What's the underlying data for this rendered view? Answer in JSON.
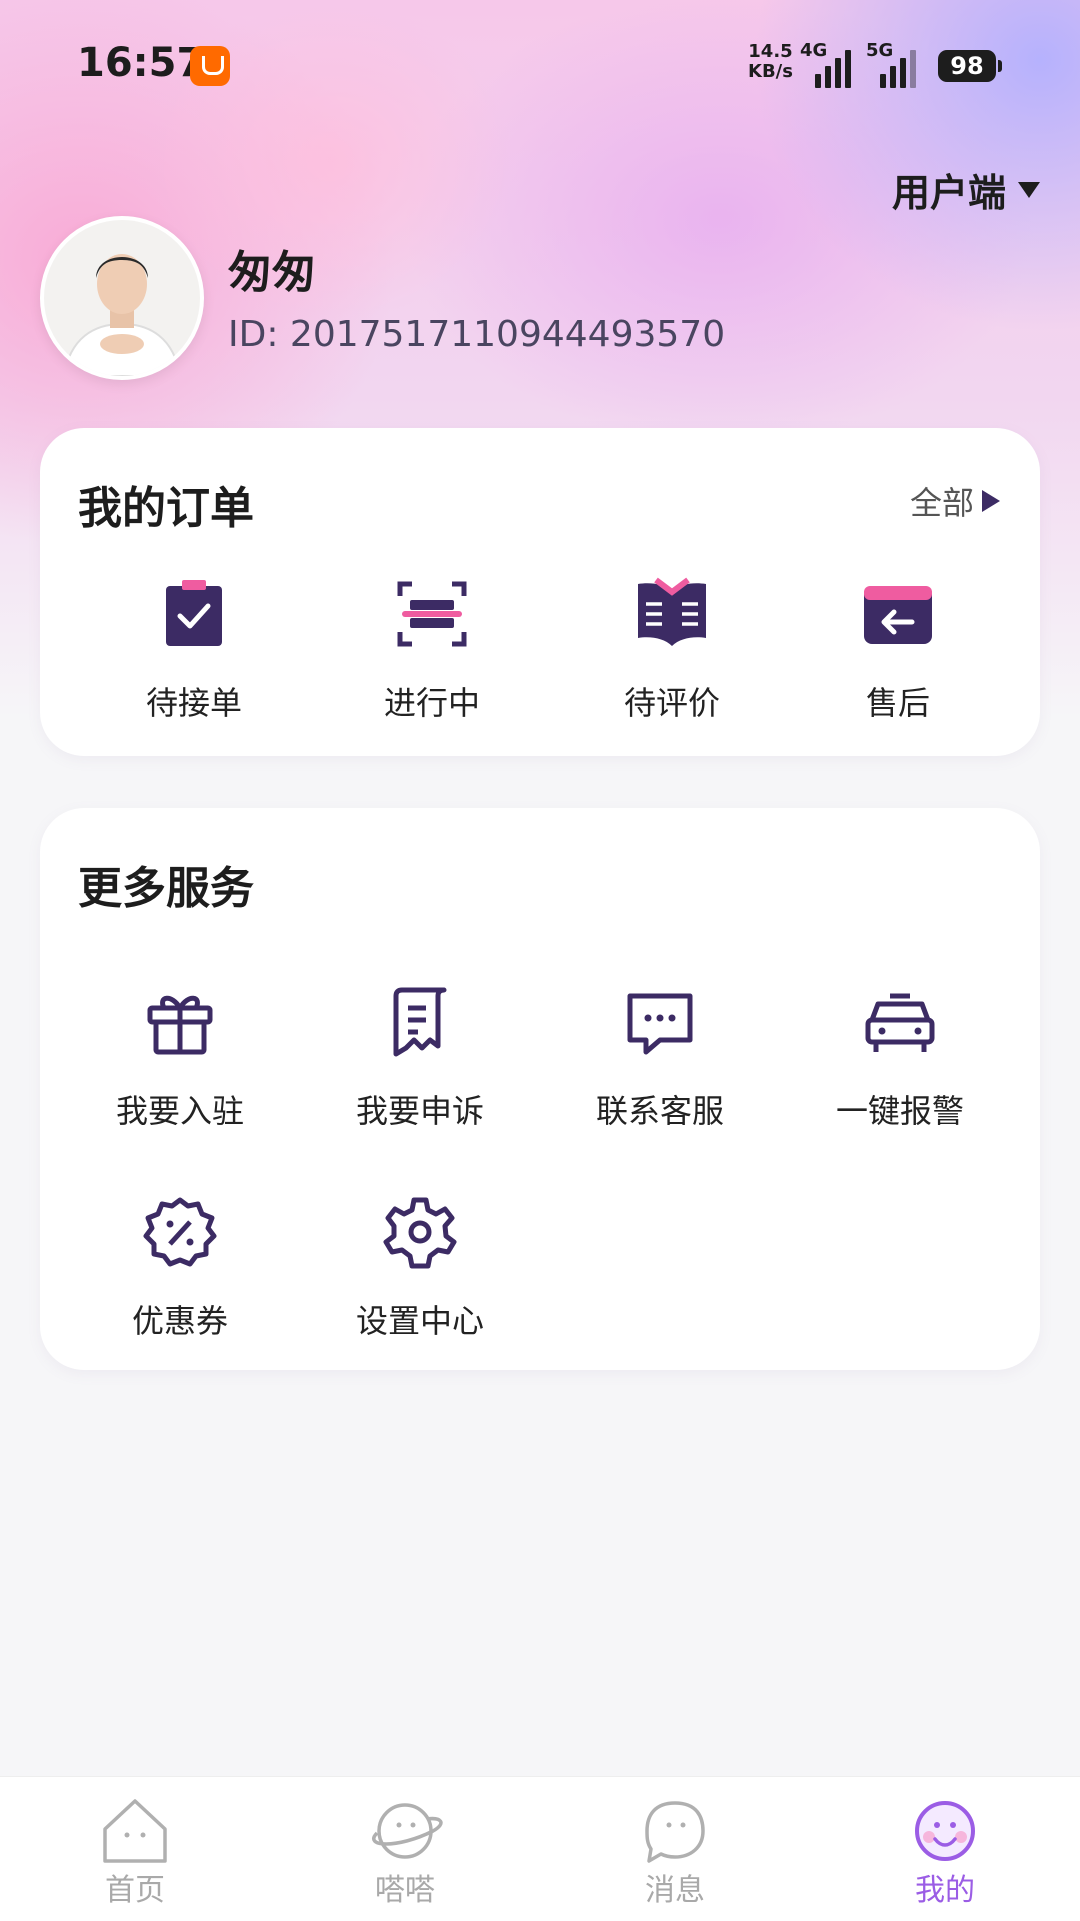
{
  "status_bar": {
    "time": "16:57",
    "net_speed_value": "14.5",
    "net_speed_unit": "KB/s",
    "signal_1": "4G",
    "signal_2": "5G",
    "battery": "98"
  },
  "header": {
    "role_label": "用户端",
    "user_name": "匆匆",
    "user_id": "ID: 2017517110944493570"
  },
  "orders": {
    "title": "我的订单",
    "see_all": "全部",
    "items": [
      {
        "label": "待接单",
        "icon": "clipboard-check-icon"
      },
      {
        "label": "进行中",
        "icon": "scan-icon"
      },
      {
        "label": "待评价",
        "icon": "open-book-icon"
      },
      {
        "label": "售后",
        "icon": "return-card-icon"
      }
    ]
  },
  "services": {
    "title": "更多服务",
    "items": [
      {
        "label": "我要入驻",
        "icon": "gift-icon"
      },
      {
        "label": "我要申诉",
        "icon": "receipt-icon"
      },
      {
        "label": "联系客服",
        "icon": "chat-bubble-icon"
      },
      {
        "label": "一键报警",
        "icon": "police-car-icon"
      },
      {
        "label": "优惠券",
        "icon": "discount-badge-icon"
      },
      {
        "label": "设置中心",
        "icon": "gear-icon"
      }
    ]
  },
  "tabbar": {
    "items": [
      {
        "label": "首页",
        "icon": "house-icon"
      },
      {
        "label": "嗒嗒",
        "icon": "planet-face-icon"
      },
      {
        "label": "消息",
        "icon": "message-face-icon"
      },
      {
        "label": "我的",
        "icon": "smile-face-icon"
      }
    ],
    "active_index": 3
  },
  "colors": {
    "accent": "#9b5de5",
    "icon_dark": "#3c2b64",
    "icon_pink": "#ef5ca0"
  }
}
